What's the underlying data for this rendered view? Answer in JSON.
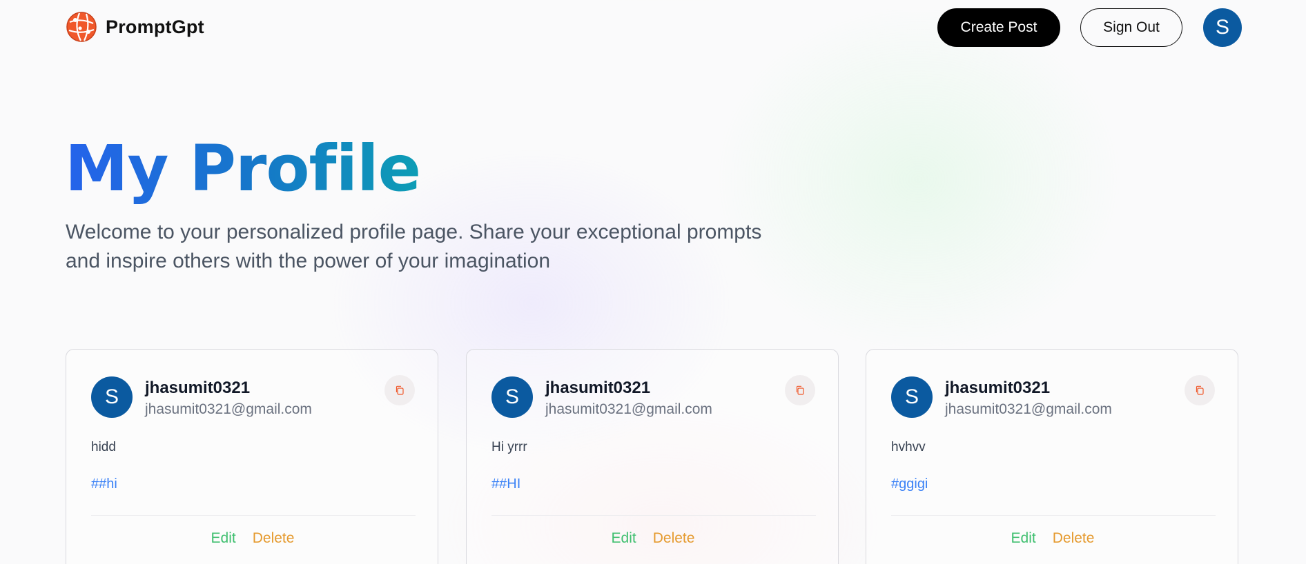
{
  "nav": {
    "brand": "PromptGpt",
    "create_label": "Create Post",
    "signout_label": "Sign Out",
    "avatar_initial": "S"
  },
  "hero": {
    "title": "My Profile",
    "description": "Welcome to your personalized profile page. Share your exceptional prompts and inspire others with the power of your imagination"
  },
  "posts": [
    {
      "initial": "S",
      "username": "jhasumit0321",
      "email": "jhasumit0321@gmail.com",
      "prompt": "hidd",
      "tag": "##hi",
      "edit": "Edit",
      "delete": "Delete"
    },
    {
      "initial": "S",
      "username": "jhasumit0321",
      "email": "jhasumit0321@gmail.com",
      "prompt": "Hi yrrr",
      "tag": "##HI",
      "edit": "Edit",
      "delete": "Delete"
    },
    {
      "initial": "S",
      "username": "jhasumit0321",
      "email": "jhasumit0321@gmail.com",
      "prompt": "hvhvv",
      "tag": "#ggigi",
      "edit": "Edit",
      "delete": "Delete"
    }
  ],
  "colors": {
    "accent_blue": "#2563eb",
    "avatar": "#0b5aa0",
    "edit": "#3fbf6f",
    "delete": "#e59a2e",
    "logo": "#f0582a"
  },
  "icons": {
    "logo": "globe-network-icon",
    "copy": "copy-icon"
  }
}
